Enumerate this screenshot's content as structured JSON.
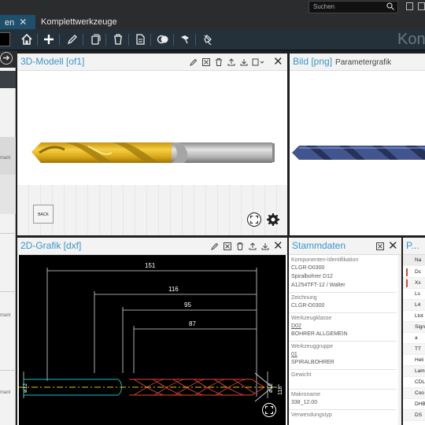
{
  "tabs": [
    {
      "label": "en",
      "active": true
    },
    {
      "label": "Komplettwerkzeuge",
      "active": false
    }
  ],
  "search": {
    "placeholder": "Suchen"
  },
  "brand": "Kon",
  "toolbar_icons": [
    "home-icon",
    "add-icon",
    "edit-icon",
    "copy-icon",
    "delete-icon",
    "document-icon",
    "merge-icon",
    "flag-icon",
    "pin-icon"
  ],
  "left_panel": {
    "items": [
      "mant",
      "mant",
      "mant"
    ]
  },
  "panel_3d": {
    "title": "3D-Modell [of1]",
    "back_label": "BACK"
  },
  "panel_image": {
    "title": "Bild [png]",
    "subtitle": "Parametergrafik"
  },
  "panel_2d": {
    "title": "2D-Grafik [dxf]",
    "dimensions": [
      "151",
      "116",
      "95",
      "87"
    ],
    "side_dims": [
      "ø12",
      "ø12",
      "118°"
    ]
  },
  "stammdaten": {
    "title": "Stammdaten",
    "sections": [
      {
        "label": "Komponenten-Identifikation",
        "values": [
          "CLGR-D0300",
          "Spiralbohrer D12",
          "A1254TFT-12 / Walter"
        ]
      },
      {
        "label": "Zeichnung",
        "values": [
          "CLGR-D0300"
        ]
      },
      {
        "label": "Werkzeugklasse",
        "values": [
          "D02",
          "BOHRER ALLGEMEIN"
        ]
      },
      {
        "label": "Werkzeuggruppe",
        "values": [
          "01",
          "SPIRALBOHRER"
        ]
      },
      {
        "label": "Gewicht",
        "values": []
      },
      {
        "label": "Makroname",
        "values": [
          "338_12.00"
        ]
      },
      {
        "label": "Verwendungstyp",
        "values": []
      }
    ]
  },
  "parameters": {
    "title": "P...",
    "header": "Na",
    "rows": [
      "Dc",
      "Xs",
      "Ls",
      "L4",
      "Ltot",
      "Sign",
      "a",
      "TT",
      "Heli",
      "Lam",
      "CDL",
      "Coo",
      "DHB",
      "DS"
    ],
    "warn_rows": [
      0,
      1
    ]
  },
  "colors": {
    "accent": "#3b93c9",
    "drill_gold": "#e6b21e",
    "drill_blue": "#3c4f8a",
    "drawing_bg": "#000000"
  }
}
